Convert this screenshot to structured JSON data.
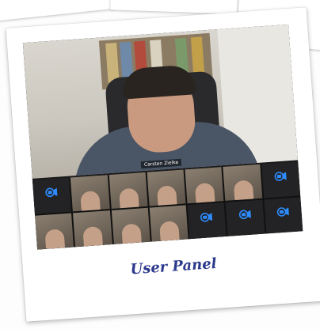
{
  "photo": {
    "caption": "User Panel",
    "caption_color": "#2d3a8c"
  },
  "meeting": {
    "active_speaker": {
      "name": "Carsten Zielke"
    },
    "participants": [
      {
        "name": "",
        "video": false
      },
      {
        "name": "",
        "video": true
      },
      {
        "name": "",
        "video": true
      },
      {
        "name": "",
        "video": true
      },
      {
        "name": "",
        "video": true
      },
      {
        "name": "",
        "video": true
      },
      {
        "name": "",
        "video": false
      },
      {
        "name": "",
        "video": true
      },
      {
        "name": "",
        "video": true
      },
      {
        "name": "",
        "video": true
      },
      {
        "name": "",
        "video": true
      },
      {
        "name": "",
        "video": false
      },
      {
        "name": "",
        "video": false
      },
      {
        "name": "",
        "video": false
      }
    ],
    "no_video_icon": "zoom-video-off-icon",
    "accent": "#2d8cff"
  }
}
